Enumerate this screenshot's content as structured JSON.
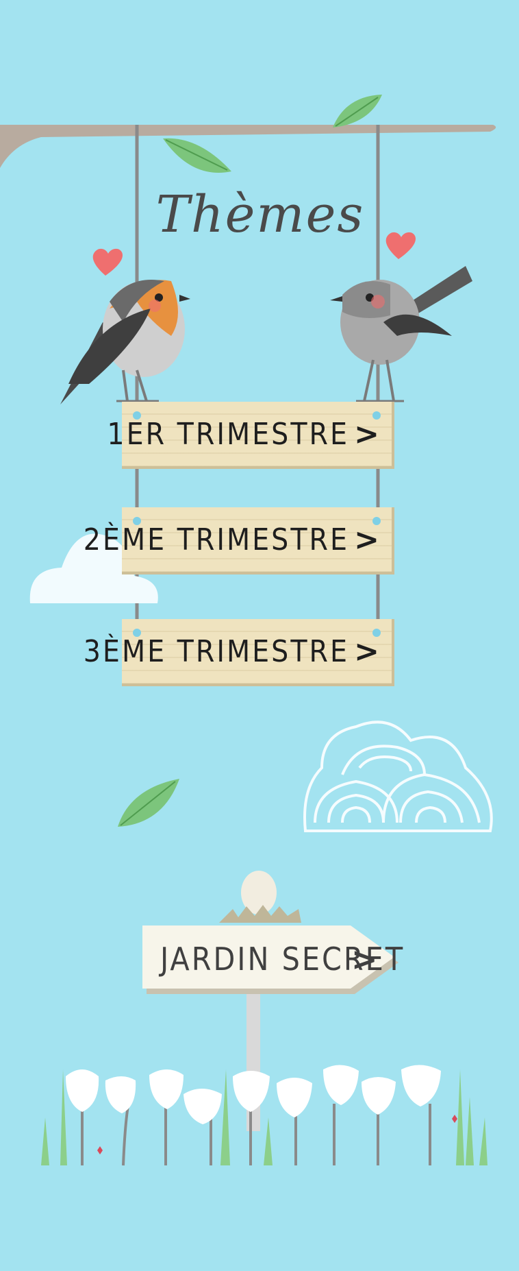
{
  "page": {
    "title": "Thèmes",
    "background_color": "#a3e3f0"
  },
  "signs": [
    {
      "label": "1ER TRIMESTRE",
      "chevron": ">"
    },
    {
      "label": "2ÈME TRIMESTRE",
      "chevron": ">"
    },
    {
      "label": "3ÈME TRIMESTRE",
      "chevron": ">"
    }
  ],
  "secret_sign": {
    "label": "JARDIN SECRET",
    "chevron": ">"
  },
  "icons": [
    "branch-icon",
    "leaf-icon",
    "heart-icon",
    "robin-icon",
    "warbler-icon",
    "cloud-icon",
    "bush-icon",
    "egg-nest-icon",
    "snowdrop-flower-icon"
  ],
  "colors": {
    "plank": "#efe3bf",
    "signpost": "#f7f5ea",
    "heart": "#ef6f6f",
    "leaf": "#7cc57c",
    "branch": "#b8ab9f"
  }
}
